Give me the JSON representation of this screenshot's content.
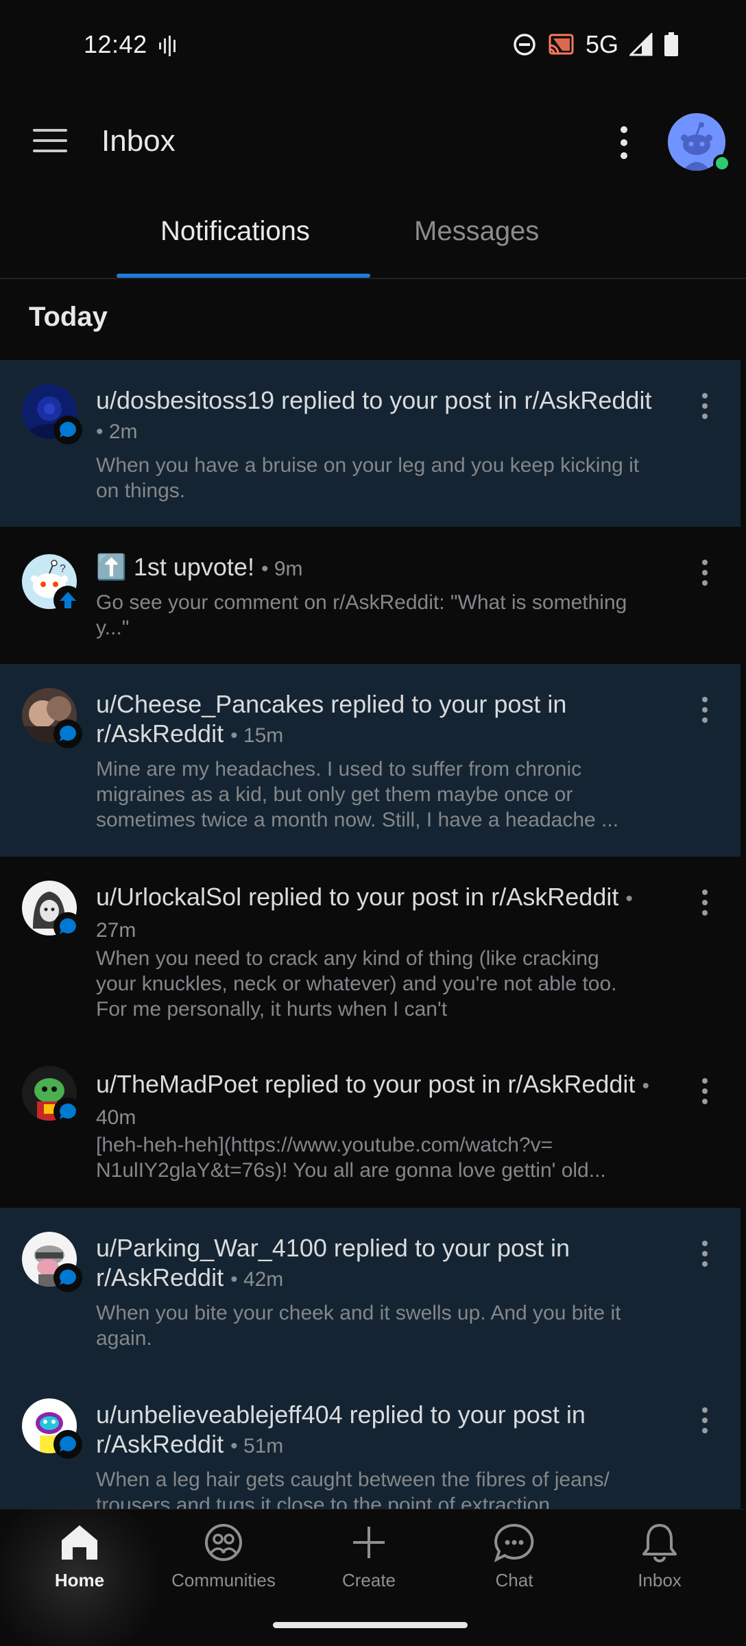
{
  "status_bar": {
    "time": "12:42",
    "network": "5G",
    "icons": [
      "voice-wave-icon",
      "do-not-disturb-icon",
      "cast-icon",
      "signal-icon",
      "battery-icon"
    ]
  },
  "app_bar": {
    "title": "Inbox",
    "icons": [
      "hamburger-menu-icon",
      "more-vertical-icon",
      "profile-avatar"
    ]
  },
  "tabs": [
    {
      "label": "Notifications",
      "active": true
    },
    {
      "label": "Messages",
      "active": false
    }
  ],
  "section": {
    "title": "Today"
  },
  "notifications": [
    {
      "title": "u/dosbesitoss19 replied to your post in r/AskReddit",
      "time": "2m",
      "body": "When you have a bruise on your leg and you keep kicking it on things.",
      "unread": true,
      "badge": "reply-icon"
    },
    {
      "title": "⬆️ 1st upvote!",
      "time": "9m",
      "body": "Go see your comment on r/AskReddit: \"What is something y...\"",
      "unread": false,
      "badge": "upvote-icon"
    },
    {
      "title": "u/Cheese_Pancakes replied to your post in r/AskReddit",
      "time": "15m",
      "body": "Mine are my headaches.  I used to suffer from chronic migraines as a kid, but only get them maybe once or sometimes twice a month now.  Still, I have a headache ...",
      "unread": true,
      "badge": "reply-icon"
    },
    {
      "title": "u/UrlockalSol replied to your post in r/AskReddit",
      "time": "27m",
      "body": "When you need to crack any kind of thing (like cracking your knuckles, neck or whatever) and you're not able too. For me personally, it hurts when I can't",
      "unread": false,
      "badge": "reply-icon"
    },
    {
      "title": "u/TheMadPoet replied to your post in r/AskReddit",
      "time": "40m",
      "body": "[heh-heh-heh](https://www.youtube.com/watch?v= N1ulIY2glaY&t=76s)! You all are gonna love gettin' old...",
      "unread": false,
      "badge": "reply-icon"
    },
    {
      "title": "u/Parking_War_4100 replied to your post in r/AskReddit",
      "time": "42m",
      "body": "When you bite your cheek and it swells up. And you bite it again.",
      "unread": true,
      "badge": "reply-icon"
    },
    {
      "title": "u/unbelieveablejeff404 replied to your post in r/AskReddit",
      "time": "51m",
      "body": "When a leg hair gets caught between the fibres of jeans/ trousers and tugs it close to the point of extraction",
      "unread": true,
      "badge": "reply-icon"
    }
  ],
  "bottom_nav": [
    {
      "label": "Home",
      "icon": "home-icon",
      "active": true
    },
    {
      "label": "Communities",
      "icon": "communities-icon",
      "active": false
    },
    {
      "label": "Create",
      "icon": "plus-icon",
      "active": false
    },
    {
      "label": "Chat",
      "icon": "chat-icon",
      "active": false
    },
    {
      "label": "Inbox",
      "icon": "bell-icon",
      "active": false
    }
  ],
  "colors": {
    "background": "#0b0b0c",
    "unread_background": "#142432",
    "accent": "#1f7bd6",
    "online": "#2ecc71"
  }
}
